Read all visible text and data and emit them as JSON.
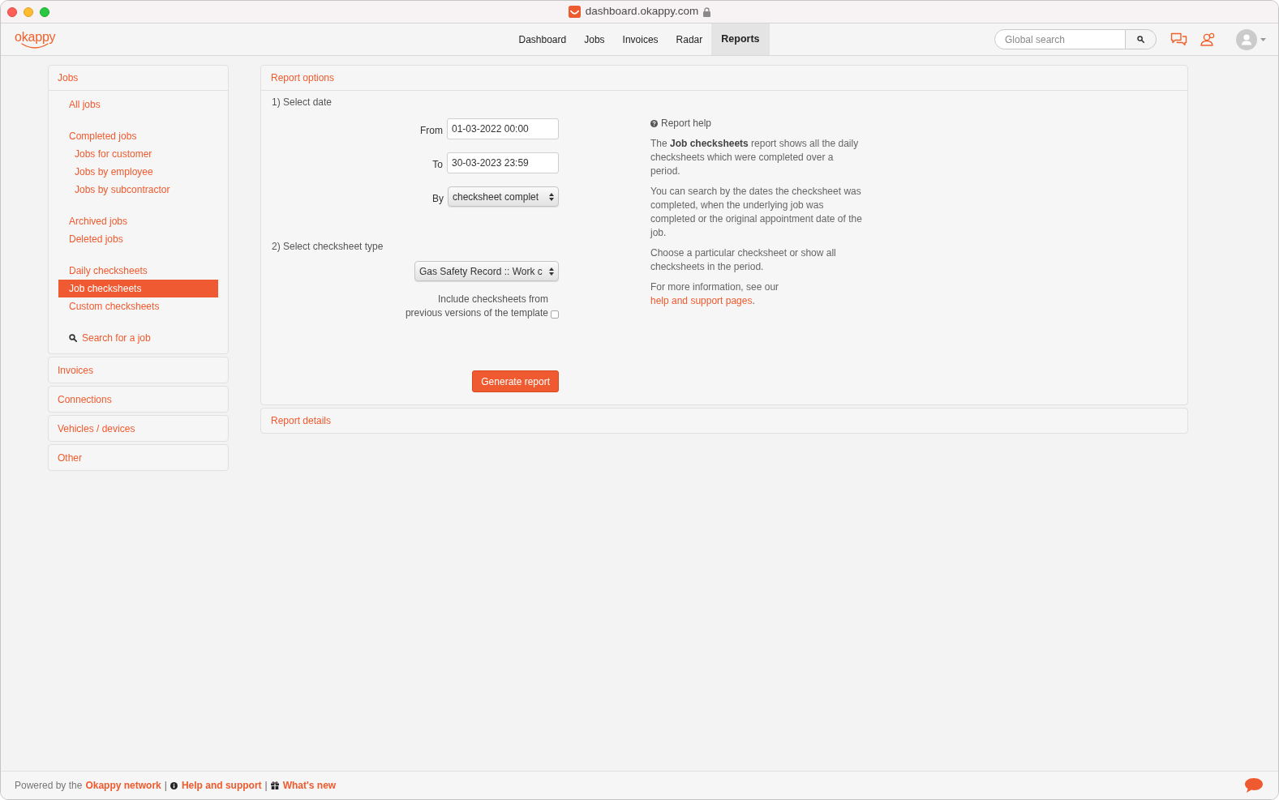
{
  "window": {
    "title": "dashboard.okappy.com"
  },
  "navbar": {
    "logo": "okappy",
    "links": [
      {
        "label": "Dashboard",
        "selected": false
      },
      {
        "label": "Jobs",
        "selected": false
      },
      {
        "label": "Invoices",
        "selected": false
      },
      {
        "label": "Radar",
        "selected": false
      },
      {
        "label": "Reports",
        "selected": true
      }
    ],
    "search": {
      "placeholder": "Global search"
    }
  },
  "sidebar": {
    "sections": [
      {
        "title": "Jobs",
        "expanded": true,
        "groups": [
          {
            "items": [
              {
                "label": "All jobs",
                "kind": "link",
                "selected": false
              }
            ]
          },
          {
            "items": [
              {
                "label": "Completed jobs",
                "kind": "link",
                "selected": false,
                "children": [
                  {
                    "label": "Jobs for customer",
                    "kind": "link",
                    "selected": false
                  },
                  {
                    "label": "Jobs by employee",
                    "kind": "link",
                    "selected": false
                  },
                  {
                    "label": "Jobs by subcontractor",
                    "kind": "link",
                    "selected": false
                  }
                ]
              }
            ]
          },
          {
            "items": [
              {
                "label": "Archived jobs",
                "kind": "link",
                "selected": false
              },
              {
                "label": "Deleted jobs",
                "kind": "link",
                "selected": false
              }
            ]
          },
          {
            "items": [
              {
                "label": "Daily checksheets",
                "kind": "link",
                "selected": false
              },
              {
                "label": "Job checksheets",
                "kind": "link",
                "selected": true
              },
              {
                "label": "Custom checksheets",
                "kind": "link",
                "selected": false
              }
            ]
          },
          {
            "items": [
              {
                "label": "Search for a job",
                "kind": "search",
                "selected": false
              }
            ]
          }
        ]
      },
      {
        "title": "Invoices",
        "expanded": false
      },
      {
        "title": "Connections",
        "expanded": false
      },
      {
        "title": "Vehicles / devices",
        "expanded": false
      },
      {
        "title": "Other",
        "expanded": false
      }
    ]
  },
  "report_options": {
    "title": "Report options",
    "expanded": true,
    "date_step": {
      "heading": "1) Select date",
      "fields": [
        {
          "label": "From",
          "kind": "input",
          "value": "01-03-2022 00:00"
        },
        {
          "label": "To",
          "kind": "input",
          "value": "30-03-2023 23:59"
        },
        {
          "label": "By",
          "kind": "select",
          "value": "checksheet complet"
        }
      ]
    },
    "type_step": {
      "heading": "2) Select checksheet type",
      "select": {
        "value": "Gas Safety Record :: Work c"
      },
      "include_previous": {
        "label": "Include checksheets from previous versions of the template",
        "checked": false
      }
    },
    "button": "Generate report",
    "help": {
      "title": "Report help",
      "paragraphs": [
        {
          "text": "The **Job checksheets** report shows all the daily checksheets which were completed over a period."
        },
        {
          "text": "You can search by the dates the checksheet was completed, when the underlying job was completed or the original appointment date of the job."
        },
        {
          "text": "Choose a particular checksheet or show all checksheets in the period."
        },
        {
          "text": "For more information, see our ",
          "link": "help and support pages",
          "after": "."
        }
      ]
    }
  },
  "report_details": {
    "title": "Report details",
    "expanded": false
  },
  "footer": {
    "text": "Powered by the",
    "links": [
      {
        "label": "Okappy network"
      },
      {
        "label": "Help and support"
      },
      {
        "label": "What's new"
      }
    ],
    "separators": [
      "|",
      "|"
    ]
  }
}
